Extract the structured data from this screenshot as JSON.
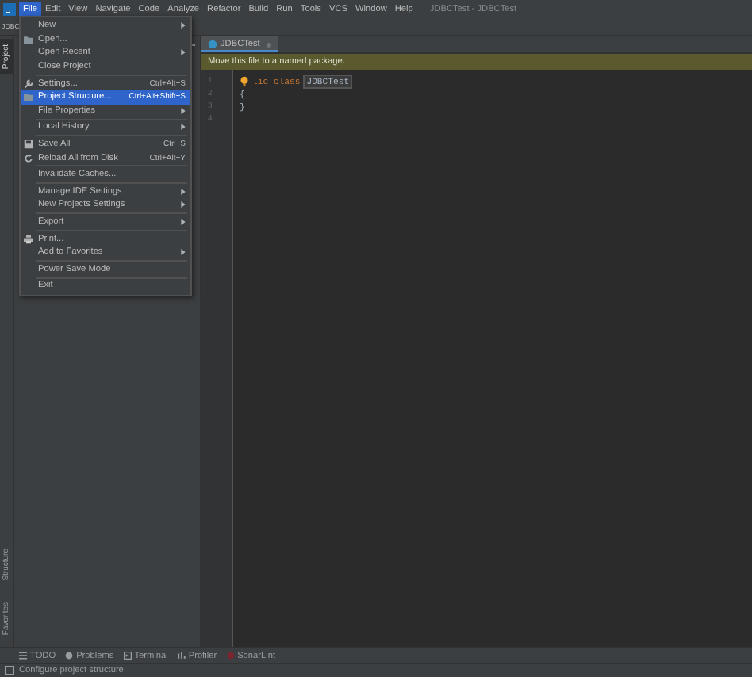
{
  "menu_bar": {
    "items": [
      {
        "label": "File",
        "selected": true
      },
      {
        "label": "Edit",
        "selected": false
      },
      {
        "label": "View",
        "selected": false
      },
      {
        "label": "Navigate",
        "selected": false
      },
      {
        "label": "Code",
        "selected": false
      },
      {
        "label": "Analyze",
        "selected": false
      },
      {
        "label": "Refactor",
        "selected": false
      },
      {
        "label": "Build",
        "selected": false
      },
      {
        "label": "Run",
        "selected": false
      },
      {
        "label": "Tools",
        "selected": false
      },
      {
        "label": "VCS",
        "selected": false
      },
      {
        "label": "Window",
        "selected": false
      },
      {
        "label": "Help",
        "selected": false
      }
    ],
    "title": "JDBCTest - JDBCTest"
  },
  "navigation_bar": {
    "breadcrumb": "JDBC"
  },
  "side_tabs": {
    "top": [
      {
        "label": "Project",
        "selected": true
      }
    ],
    "bottom": [
      {
        "label": "Structure",
        "selected": false
      },
      {
        "label": "Favorites",
        "selected": false
      }
    ]
  },
  "file_menu": {
    "items": [
      {
        "kind": "item",
        "label": "New",
        "submenu": true,
        "selected": false
      },
      {
        "kind": "folder",
        "label": "Open...",
        "selected": false
      },
      {
        "kind": "item",
        "label": "Open Recent",
        "submenu": true,
        "selected": false
      },
      {
        "kind": "item",
        "label": "Close Project",
        "selected": false
      },
      {
        "kind": "separator"
      },
      {
        "kind": "wrench",
        "label": "Settings...",
        "shortcut": "Ctrl+Alt+S",
        "selected": false
      },
      {
        "kind": "folder",
        "label": "Project Structure...",
        "shortcut": "Ctrl+Alt+Shift+S",
        "selected": true
      },
      {
        "kind": "item",
        "label": "File Properties",
        "submenu": true,
        "selected": false
      },
      {
        "kind": "separator"
      },
      {
        "kind": "item",
        "label": "Local History",
        "submenu": true,
        "selected": false
      },
      {
        "kind": "separator"
      },
      {
        "kind": "save",
        "label": "Save All",
        "shortcut": "Ctrl+S",
        "selected": false
      },
      {
        "kind": "reload",
        "label": "Reload All from Disk",
        "shortcut": "Ctrl+Alt+Y",
        "selected": false
      },
      {
        "kind": "separator"
      },
      {
        "kind": "item",
        "label": "Invalidate Caches...",
        "selected": false
      },
      {
        "kind": "separator"
      },
      {
        "kind": "item",
        "label": "Manage IDE Settings",
        "submenu": true,
        "selected": false
      },
      {
        "kind": "item",
        "label": "New Projects Settings",
        "submenu": true,
        "selected": false
      },
      {
        "kind": "separator"
      },
      {
        "kind": "item",
        "label": "Export",
        "submenu": true,
        "selected": false
      },
      {
        "kind": "separator"
      },
      {
        "kind": "print",
        "label": "Print...",
        "selected": false
      },
      {
        "kind": "item",
        "label": "Add to Favorites",
        "submenu": true,
        "selected": false
      },
      {
        "kind": "separator"
      },
      {
        "kind": "item",
        "label": "Power Save Mode",
        "selected": false
      },
      {
        "kind": "separator"
      },
      {
        "kind": "item",
        "label": "Exit",
        "selected": false
      }
    ]
  },
  "editor": {
    "tabs": [
      {
        "label": "JDBCTest",
        "selected": true
      }
    ],
    "banner": "Move this file to a named package.",
    "lines": [
      {
        "number": "1",
        "keyword": "lic class",
        "name": "JDBCTest",
        "bulb": true
      },
      {
        "number": "2",
        "text": "{"
      },
      {
        "number": "3",
        "text": "}"
      },
      {
        "number": "4"
      }
    ]
  },
  "tool_windows": [
    {
      "label": "TODO",
      "kind": "list"
    },
    {
      "label": "Problems",
      "kind": "warning"
    },
    {
      "label": "Terminal",
      "kind": "terminal"
    },
    {
      "label": "Profiler",
      "kind": "profiler"
    },
    {
      "label": "SonarLint",
      "kind": "sonar"
    }
  ],
  "status_bar": {
    "text": "Configure project structure"
  }
}
